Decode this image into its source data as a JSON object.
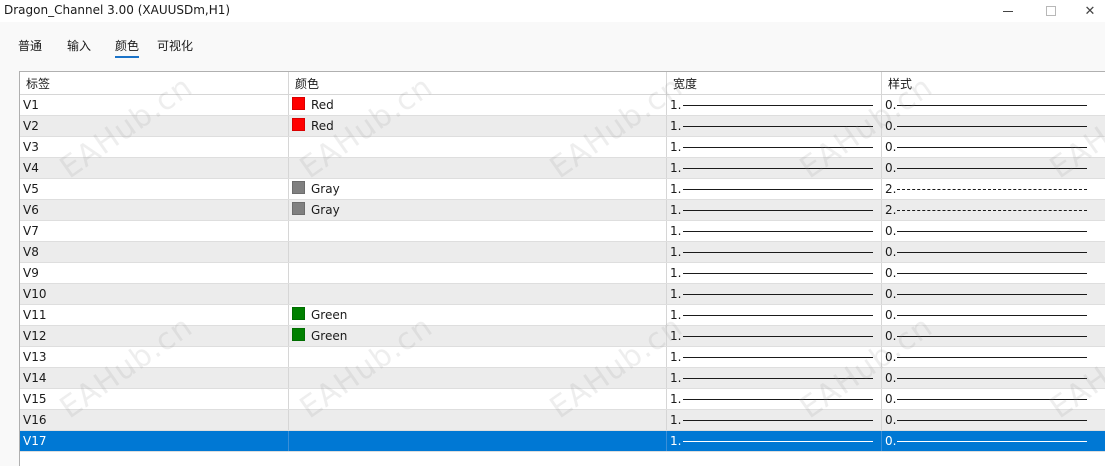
{
  "window": {
    "title": "Dragon_Channel 3.00 (XAUUSDm,H1)",
    "controls": {
      "minimize": "",
      "maximize": "",
      "close": "✕"
    }
  },
  "tabs": [
    {
      "label": "普通",
      "active": false
    },
    {
      "label": "输入",
      "active": false
    },
    {
      "label": "颜色",
      "active": true
    },
    {
      "label": "可视化",
      "active": false
    }
  ],
  "table": {
    "headers": [
      "标签",
      "颜色",
      "宽度",
      "样式"
    ],
    "rows": [
      {
        "label": "V1",
        "color_name": "Red",
        "color_hex": "#ff0000",
        "width": "1.",
        "style": "0.",
        "style_line": "solid"
      },
      {
        "label": "V2",
        "color_name": "Red",
        "color_hex": "#ff0000",
        "width": "1.",
        "style": "0.",
        "style_line": "solid"
      },
      {
        "label": "V3",
        "color_name": "",
        "color_hex": "",
        "width": "1.",
        "style": "0.",
        "style_line": "solid"
      },
      {
        "label": "V4",
        "color_name": "",
        "color_hex": "",
        "width": "1.",
        "style": "0.",
        "style_line": "solid"
      },
      {
        "label": "V5",
        "color_name": "Gray",
        "color_hex": "#808080",
        "width": "1.",
        "style": "2.",
        "style_line": "dashed"
      },
      {
        "label": "V6",
        "color_name": "Gray",
        "color_hex": "#808080",
        "width": "1.",
        "style": "2.",
        "style_line": "dashed"
      },
      {
        "label": "V7",
        "color_name": "",
        "color_hex": "",
        "width": "1.",
        "style": "0.",
        "style_line": "solid"
      },
      {
        "label": "V8",
        "color_name": "",
        "color_hex": "",
        "width": "1.",
        "style": "0.",
        "style_line": "solid"
      },
      {
        "label": "V9",
        "color_name": "",
        "color_hex": "",
        "width": "1.",
        "style": "0.",
        "style_line": "solid"
      },
      {
        "label": "V10",
        "color_name": "",
        "color_hex": "",
        "width": "1.",
        "style": "0.",
        "style_line": "solid"
      },
      {
        "label": "V11",
        "color_name": "Green",
        "color_hex": "#008000",
        "width": "1.",
        "style": "0.",
        "style_line": "solid"
      },
      {
        "label": "V12",
        "color_name": "Green",
        "color_hex": "#008000",
        "width": "1.",
        "style": "0.",
        "style_line": "solid"
      },
      {
        "label": "V13",
        "color_name": "",
        "color_hex": "",
        "width": "1.",
        "style": "0.",
        "style_line": "solid"
      },
      {
        "label": "V14",
        "color_name": "",
        "color_hex": "",
        "width": "1.",
        "style": "0.",
        "style_line": "solid"
      },
      {
        "label": "V15",
        "color_name": "",
        "color_hex": "",
        "width": "1.",
        "style": "0.",
        "style_line": "solid"
      },
      {
        "label": "V16",
        "color_name": "",
        "color_hex": "",
        "width": "1.",
        "style": "0.",
        "style_line": "solid"
      },
      {
        "label": "V17",
        "color_name": "",
        "color_hex": "",
        "width": "1.",
        "style": "0.",
        "style_line": "solid",
        "selected": true
      }
    ]
  },
  "watermark": {
    "text": "EAHub.cn"
  },
  "colors": {
    "accent": "#0078d4",
    "row_alt": "#ececec"
  }
}
